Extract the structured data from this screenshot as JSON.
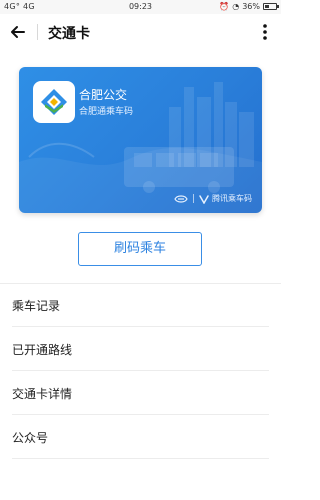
{
  "status": {
    "left": "4G° 4G",
    "time": "09:23",
    "battery": "36%"
  },
  "header": {
    "title": "交通卡"
  },
  "card": {
    "title": "合肥公交",
    "subtitle": "合肥通乘车码",
    "brand": "腾讯乘车码",
    "color": "#2f8fe6"
  },
  "actions": {
    "scan_label": "刷码乘车"
  },
  "menu": [
    {
      "label": "乘车记录"
    },
    {
      "label": "已开通路线"
    },
    {
      "label": "交通卡详情"
    },
    {
      "label": "公众号"
    }
  ]
}
